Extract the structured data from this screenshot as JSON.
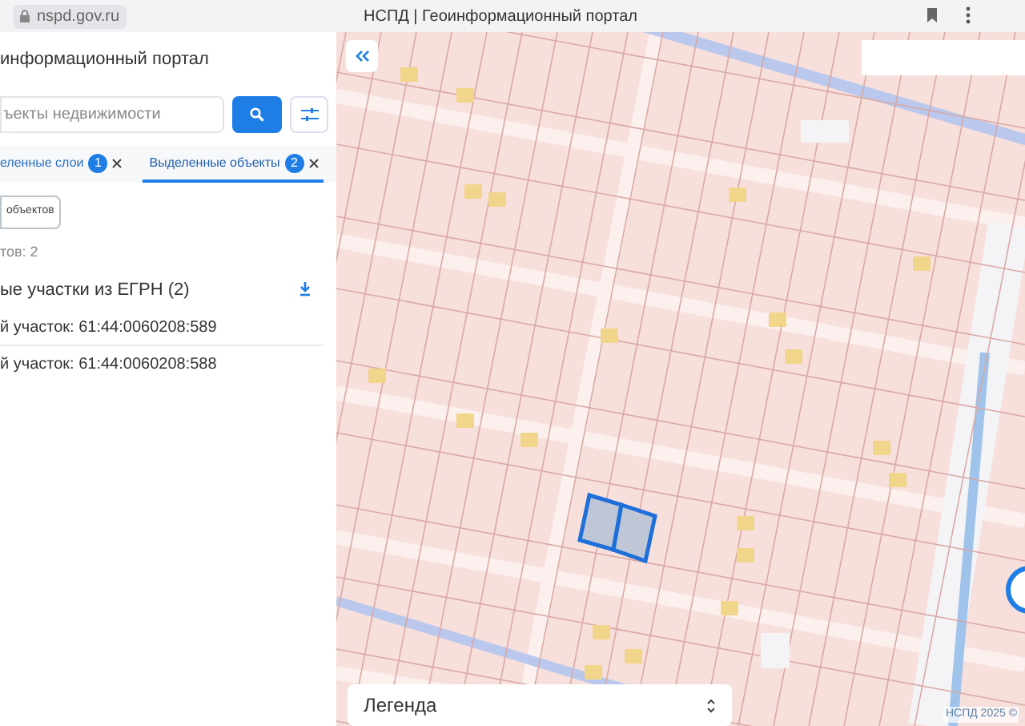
{
  "browser": {
    "address": "nspd.gov.ru",
    "title": "НСПД | Геоинформационный портал"
  },
  "panel": {
    "title": "информационный портал",
    "search": {
      "placeholder": "ъекты недвижимости"
    },
    "tabs": [
      {
        "label": "еленные слои",
        "badge": "1",
        "selected": false
      },
      {
        "label": "Выделенные объекты",
        "badge": "2",
        "selected": true
      }
    ],
    "objects_button": "объектов",
    "count": "тов: 2",
    "group": {
      "title": "ые участки из ЕГРН (2)"
    },
    "items": [
      "й участок: 61:44:0060208:589",
      "й участок: 61:44:0060208:588"
    ]
  },
  "map": {
    "legend": "Легенда",
    "copyright": "НСПД 2025 ©"
  }
}
